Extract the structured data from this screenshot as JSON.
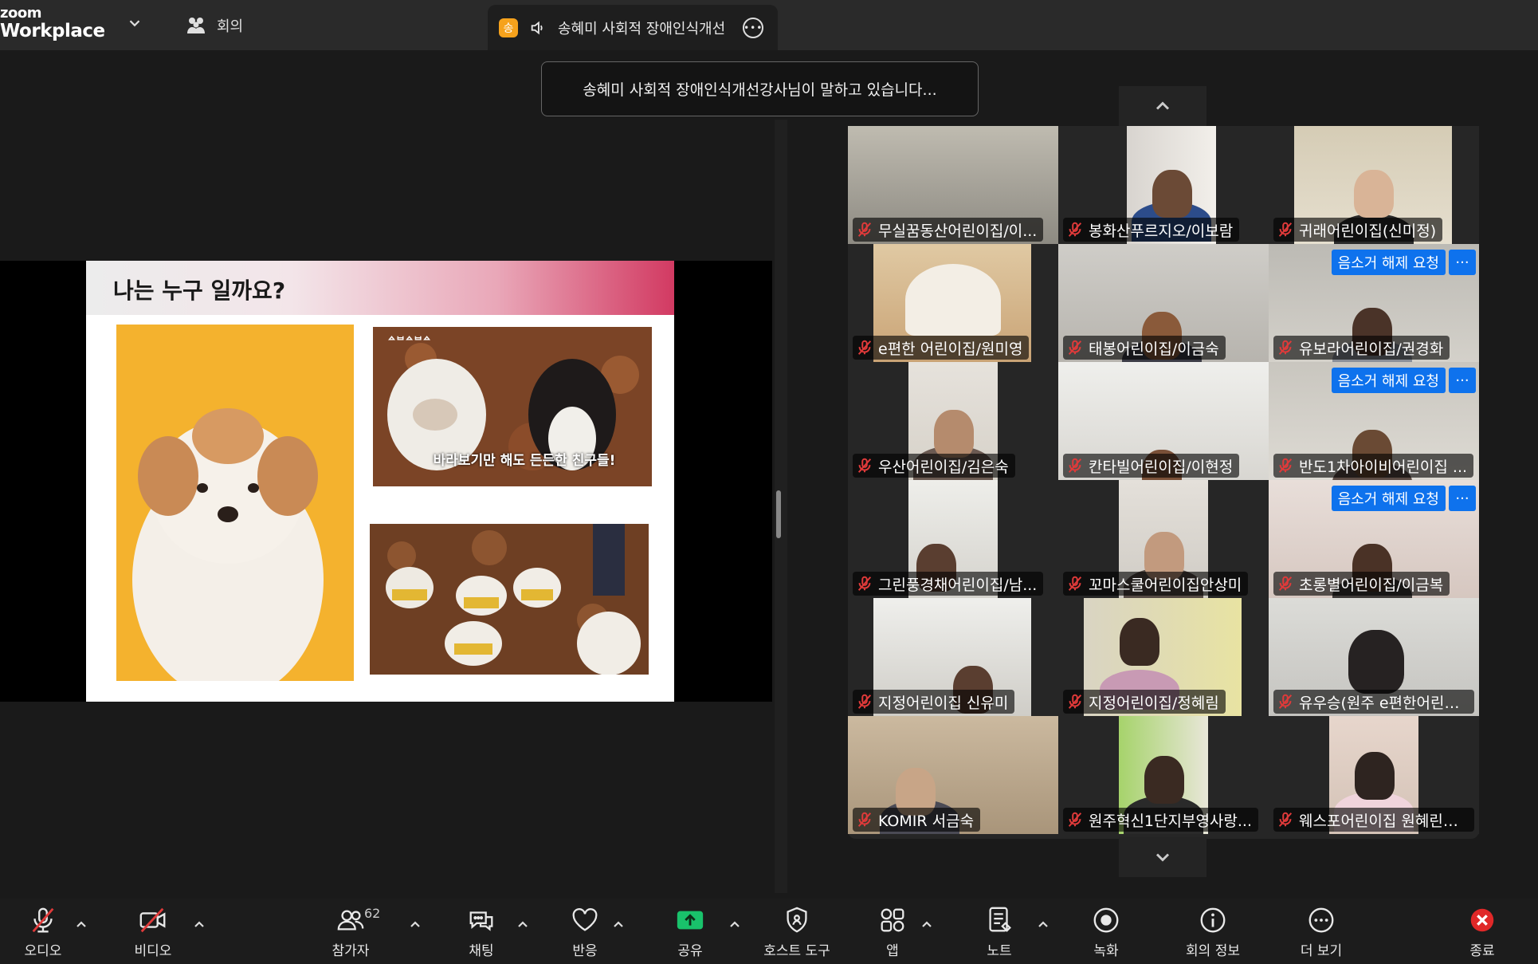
{
  "app": {
    "logo_line1": "zoom",
    "logo_line2": "Workplace"
  },
  "topbar": {
    "meeting_tab_label": "회의",
    "speaker_tab_avatar": "송",
    "speaker_tab_label": "송혜미 사회적 장애인식개선"
  },
  "toast": "송혜미 사회적 장애인식개선강사님이 말하고 있습니다...",
  "slide": {
    "title": "나는 누구 일까요?",
    "caption": "바라보기만 해도 든든한 친구들!",
    "tag": "ᅀᄇᅀᄇᅀ"
  },
  "gallery": {
    "unmute_label": "음소거 해제 요청",
    "more_label": "···",
    "tiles": [
      {
        "name": "무실꿈동산어린이집/이..."
      },
      {
        "name": "봉화산푸르지오/이보람"
      },
      {
        "name": "귀래어린이집(신미정)"
      },
      {
        "name": "e편한 어린이집/원미영"
      },
      {
        "name": "태봉어린이집/이금숙"
      },
      {
        "name": "유보라어린이집/권경화"
      },
      {
        "name": "우산어린이집/김은숙"
      },
      {
        "name": "칸타빌어린이집/이현정"
      },
      {
        "name": "반도1차아이비어린이집 ..."
      },
      {
        "name": "그린풍경채어린이집/남..."
      },
      {
        "name": "꼬마스쿨어린이집안상미"
      },
      {
        "name": "초롱별어린이집/이금복"
      },
      {
        "name": "지정어린이집 신유미"
      },
      {
        "name": "지정어린이집/정혜림"
      },
      {
        "name": "유우승(원주 e편한어린이..."
      },
      {
        "name": "KOMIR 서금숙"
      },
      {
        "name": "원주혁신1단지부영사랑..."
      },
      {
        "name": "웨스포어린이집 원혜린교..."
      }
    ]
  },
  "toolbar": {
    "audio": "오디오",
    "video": "비디오",
    "participants": "참가자",
    "participants_count": "62",
    "chat": "채팅",
    "reactions": "반응",
    "share": "공유",
    "host_tools": "호스트 도구",
    "apps": "앱",
    "notes": "노트",
    "record": "녹화",
    "meeting_info": "회의 정보",
    "more": "더 보기",
    "end": "종료"
  },
  "colors": {
    "accent": "#0e72ed",
    "share_green": "#19c26b",
    "end_red": "#e02828",
    "muted_red": "#e03a3a"
  }
}
